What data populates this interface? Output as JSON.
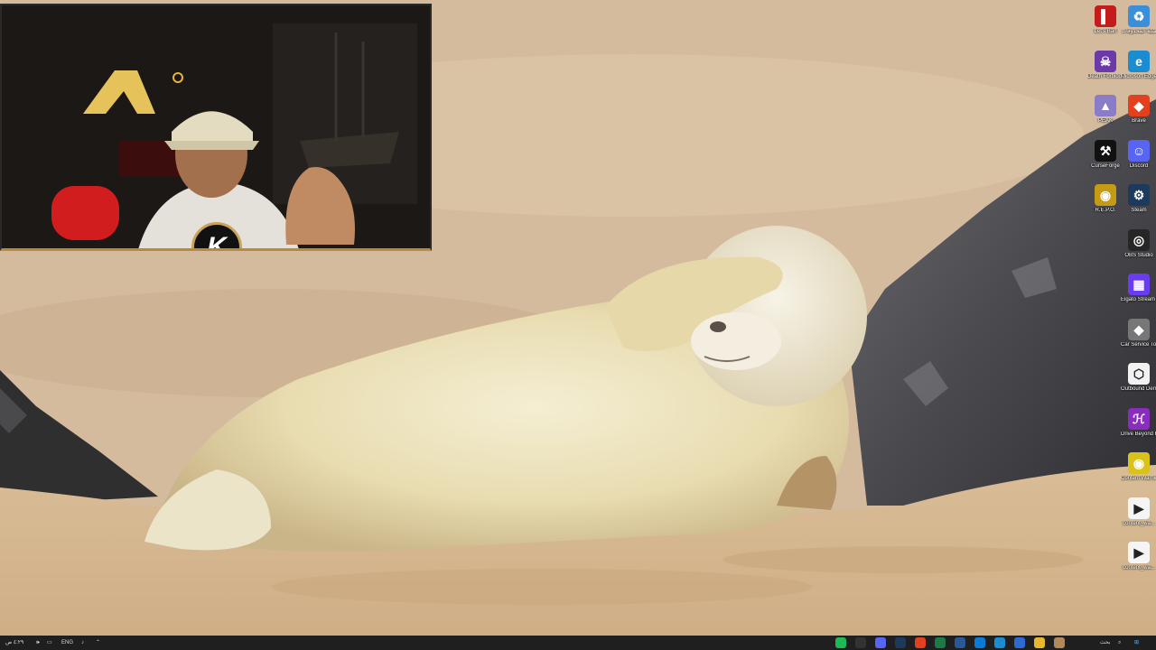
{
  "webcam": {
    "badge_letter": "K"
  },
  "desktop_icons_col1": [
    {
      "name": "lets-ban-icon",
      "label": "Let's Ban",
      "color": "#c41b1b",
      "glyph": "▌"
    },
    {
      "name": "death-forbidden-icon",
      "label": "Death Forbidden",
      "color": "#6b3aa8",
      "glyph": "☠"
    },
    {
      "name": "peak-icon",
      "label": "PEAK",
      "color": "#8a7cc9",
      "glyph": "▲"
    },
    {
      "name": "curseforge-icon",
      "label": "CurseForge",
      "color": "#111111",
      "glyph": "⚒"
    },
    {
      "name": "repo-icon",
      "label": "R.E.P.O.",
      "color": "#c79a16",
      "glyph": "◉"
    }
  ],
  "desktop_icons_col2": [
    {
      "name": "recycle-bin-icon",
      "label": "سلة المحذوفات",
      "color": "#3b8fd9",
      "glyph": "♻"
    },
    {
      "name": "edge-icon",
      "label": "Microsoft Edge",
      "color": "#1b8ccf",
      "glyph": "e"
    },
    {
      "name": "brave-icon",
      "label": "Brave",
      "color": "#e2401e",
      "glyph": "◆"
    },
    {
      "name": "discord-icon",
      "label": "Discord",
      "color": "#5865f2",
      "glyph": "☺"
    },
    {
      "name": "steam-icon",
      "label": "Steam",
      "color": "#1b3a5c",
      "glyph": "⚙"
    },
    {
      "name": "obs-studio-icon",
      "label": "OBS Studio",
      "color": "#262626",
      "glyph": "◎"
    },
    {
      "name": "elgato-stream-deck-icon",
      "label": "Elgato Stream Deck",
      "color": "#6a3cf0",
      "glyph": "▦"
    },
    {
      "name": "car-service-together-icon",
      "label": "Car Service Together",
      "color": "#777777",
      "glyph": "◆"
    },
    {
      "name": "outbound-demo-icon",
      "label": "Outbound Demo",
      "color": "#f2f2f2",
      "glyph": "⬡"
    },
    {
      "name": "drive-beyond-horizons-icon",
      "label": "Drive Beyond Horizons",
      "color": "#8a2dbf",
      "glyph": "ℋ"
    },
    {
      "name": "content-warning-icon",
      "label": "Content Warning",
      "color": "#d9c21c",
      "glyph": "◉"
    },
    {
      "name": "content-file-1-icon",
      "label": "content_wa...",
      "color": "#f5f5f5",
      "glyph": "▶"
    },
    {
      "name": "content-file-2-icon",
      "label": "content_wa...",
      "color": "#f5f5f5",
      "glyph": "▶"
    }
  ],
  "taskbar": {
    "clock_time": "٤:٢٩ ص",
    "clock_date": "٢٧/٠٧/٢٠٢٥",
    "lang": "ENG",
    "search_placeholder": "بحث",
    "pinned_apps": [
      {
        "name": "spotify-taskbar-icon",
        "color": "#1db954"
      },
      {
        "name": "obs-taskbar-icon",
        "color": "#333333"
      },
      {
        "name": "discord-taskbar-icon",
        "color": "#5865f2"
      },
      {
        "name": "steam-taskbar-icon",
        "color": "#1b3a5c"
      },
      {
        "name": "brave-taskbar-icon",
        "color": "#e2401e"
      },
      {
        "name": "excel-taskbar-icon",
        "color": "#1d7a45"
      },
      {
        "name": "word-taskbar-icon",
        "color": "#2b5797"
      },
      {
        "name": "store-taskbar-icon",
        "color": "#0a7bd6"
      },
      {
        "name": "edge-taskbar-icon",
        "color": "#1b8ccf"
      },
      {
        "name": "calendar-taskbar-icon",
        "color": "#2d6bd3"
      },
      {
        "name": "explorer-taskbar-icon",
        "color": "#e8b72f"
      },
      {
        "name": "game-taskbar-icon",
        "color": "#b08a5a"
      }
    ]
  }
}
